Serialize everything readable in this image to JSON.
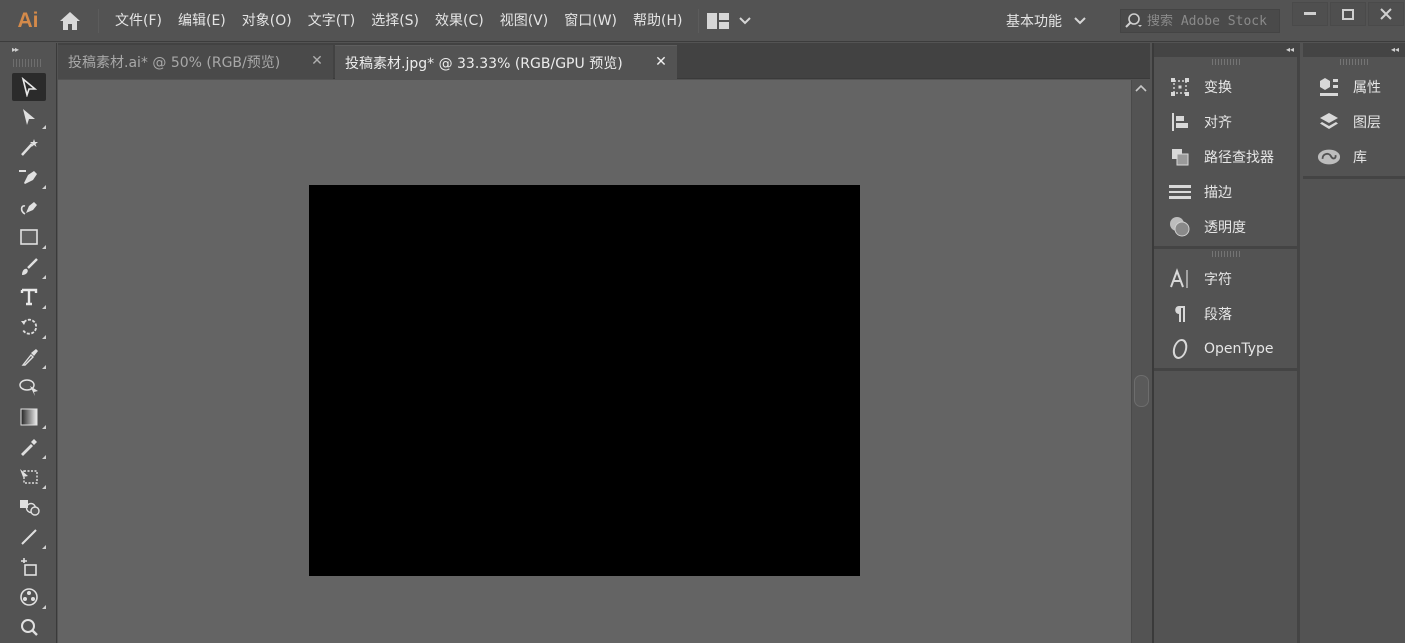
{
  "app": {
    "logo": "Ai"
  },
  "menubar": {
    "items": [
      {
        "label": "文件(F)"
      },
      {
        "label": "编辑(E)"
      },
      {
        "label": "对象(O)"
      },
      {
        "label": "文字(T)"
      },
      {
        "label": "选择(S)"
      },
      {
        "label": "效果(C)"
      },
      {
        "label": "视图(V)"
      },
      {
        "label": "窗口(W)"
      },
      {
        "label": "帮助(H)"
      }
    ],
    "workspace": "基本功能",
    "search_placeholder": "搜索 Adobe Stock",
    "window_controls": {
      "minimize": "—",
      "maximize": "□",
      "close": "✕"
    }
  },
  "tabs": [
    {
      "label": "投稿素材.ai* @ 50% (RGB/预览)",
      "active": false,
      "close": "✕"
    },
    {
      "label": "投稿素材.jpg* @ 33.33% (RGB/GPU 预览)",
      "active": true,
      "close": "✕"
    }
  ],
  "toolbar": {
    "collapse": "▸▸",
    "tools": [
      "selection-tool",
      "direct-selection-tool",
      "magic-wand-tool",
      "pen-tool",
      "curvature-tool",
      "rectangle-tool",
      "paintbrush-tool",
      "type-tool",
      "rotate-tool",
      "eyedropper-width-tool",
      "shape-builder-tool",
      "gradient-tool",
      "eyedropper-tool",
      "free-transform-tool",
      "blend-tool",
      "line-segment-tool",
      "artboard-tool",
      "symbol-sprayer-tool",
      "zoom-tool"
    ]
  },
  "canvas": {
    "artboard_color": "#000000",
    "pasteboard_color": "#646464"
  },
  "panels": {
    "collapse": "◂◂",
    "column1_group1": [
      {
        "label": "变换",
        "icon": "transform-icon"
      },
      {
        "label": "对齐",
        "icon": "align-icon"
      },
      {
        "label": "路径查找器",
        "icon": "pathfinder-icon"
      },
      {
        "label": "描边",
        "icon": "stroke-icon"
      },
      {
        "label": "透明度",
        "icon": "transparency-icon"
      }
    ],
    "column1_group2": [
      {
        "label": "字符",
        "icon": "character-icon"
      },
      {
        "label": "段落",
        "icon": "paragraph-icon"
      },
      {
        "label": "OpenType",
        "icon": "opentype-icon"
      }
    ],
    "column2": [
      {
        "label": "属性",
        "icon": "properties-icon"
      },
      {
        "label": "图层",
        "icon": "layers-icon"
      },
      {
        "label": "库",
        "icon": "libraries-icon"
      }
    ]
  }
}
